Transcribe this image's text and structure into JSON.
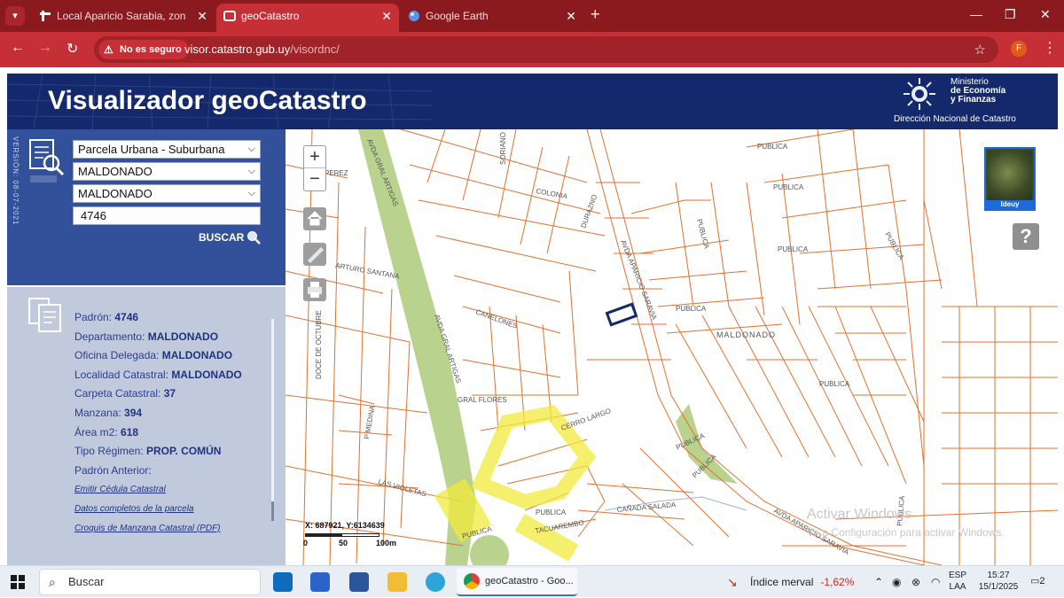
{
  "browser": {
    "tabs": [
      {
        "title": "Local Aparicio Sarabia, zona Ba",
        "active": false
      },
      {
        "title": "geoCatastro",
        "active": true
      },
      {
        "title": "Google Earth",
        "active": false
      }
    ],
    "insecure_label": "No es seguro",
    "url_host": "visor.catastro.gub.uy",
    "url_path": "/visordnc/",
    "profile_initial": "F"
  },
  "header": {
    "title": "Visualizador geoCatastro",
    "ministry_line1": "Ministerio",
    "ministry_line2": "de Economía",
    "ministry_line3": "y Finanzas",
    "direction": "Dirección Nacional de Catastro"
  },
  "search_panel": {
    "version": "VERSIÓN: 08-07-2021",
    "parcel_type": "Parcela Urbana - Suburbana",
    "department": "MALDONADO",
    "locality": "MALDONADO",
    "padron_value": "4746",
    "search_label": "BUSCAR"
  },
  "info_panel": {
    "padron_label": "Padrón:",
    "padron": "4746",
    "departamento_label": "Departamento:",
    "departamento": "MALDONADO",
    "oficina_label": "Oficina Delegada:",
    "oficina": "MALDONADO",
    "localidad_label": "Localidad Catastral:",
    "localidad": "MALDONADO",
    "carpeta_label": "Carpeta Catastral:",
    "carpeta": "37",
    "manzana_label": "Manzana:",
    "manzana": "394",
    "area_label": "Área m2:",
    "area": "618",
    "regimen_label": "Tipo Régimen:",
    "regimen": "PROP. COMÚN",
    "padron_anterior_label": "Padrón Anterior:",
    "link_cedula": "Emitir Cédula Catastral",
    "link_datos": "Datos completos de la parcela",
    "link_croquis": "Croquis de Manzana Catastral (PDF)"
  },
  "map": {
    "streets": {
      "artigas1": "AVDA GRAL ARTIGAS",
      "artigas2": "AVDA GRAL ARTIGAS",
      "perez": "PEREZ",
      "soriano": "SORIANO",
      "colonia": "COLONIA",
      "durazno": "DURAZNO",
      "saravia1": "AVDA APARICIO SARAVIA",
      "publica1": "PUBLICA",
      "publica2": "PUBLICA",
      "publica3": "PUBLICA",
      "publica4": "PUBLICA",
      "publica5": "PUBLICA",
      "publica6": "PUBLICA",
      "publica7": "PUBLICA",
      "publica8": "PUBLICA",
      "publica9": "PUBLICA",
      "publica10": "PUBLICA",
      "publica11": "PUBLICA",
      "publica12": "PUBLICA",
      "arturo": "ARTURO SANTANA",
      "canelones": "CANELONES",
      "doce": "DOCE DE OCTUBRE",
      "maldonado": "MALDONADO",
      "gral_flores": "GRAL FLORES",
      "cerro_largo": "CERRO LARGO",
      "medina": "P MEDINA",
      "violetas": "LAS VIOLETAS",
      "taguarembo": "TACUAREMBO",
      "canada": "CAÑADA SALADA",
      "saravia2": "AVDA APARICIO SARAVIA"
    },
    "ideuy_label": "Ideuy",
    "help_symbol": "?",
    "coords": "X: 687921, Y:6134639",
    "scale_0": "0",
    "scale_50": "50",
    "scale_100": "100m",
    "watermark_title": "Activar Windows",
    "watermark_sub": "Ve a Configuración para activar Windows.",
    "colors": {
      "parcel_lines": "#e0712f",
      "selected": "#13296b",
      "park": "#b9d28d",
      "highlight": "#f1ea3c"
    }
  },
  "taskbar": {
    "search_label": "Buscar",
    "active_app": "geoCatastro - Goo...",
    "stock_name": "Índice merval",
    "stock_change": "-1,62%",
    "lang1": "ESP",
    "lang2": "LAA",
    "time": "15:27",
    "date": "15/1/2025",
    "notif_count": "2"
  }
}
